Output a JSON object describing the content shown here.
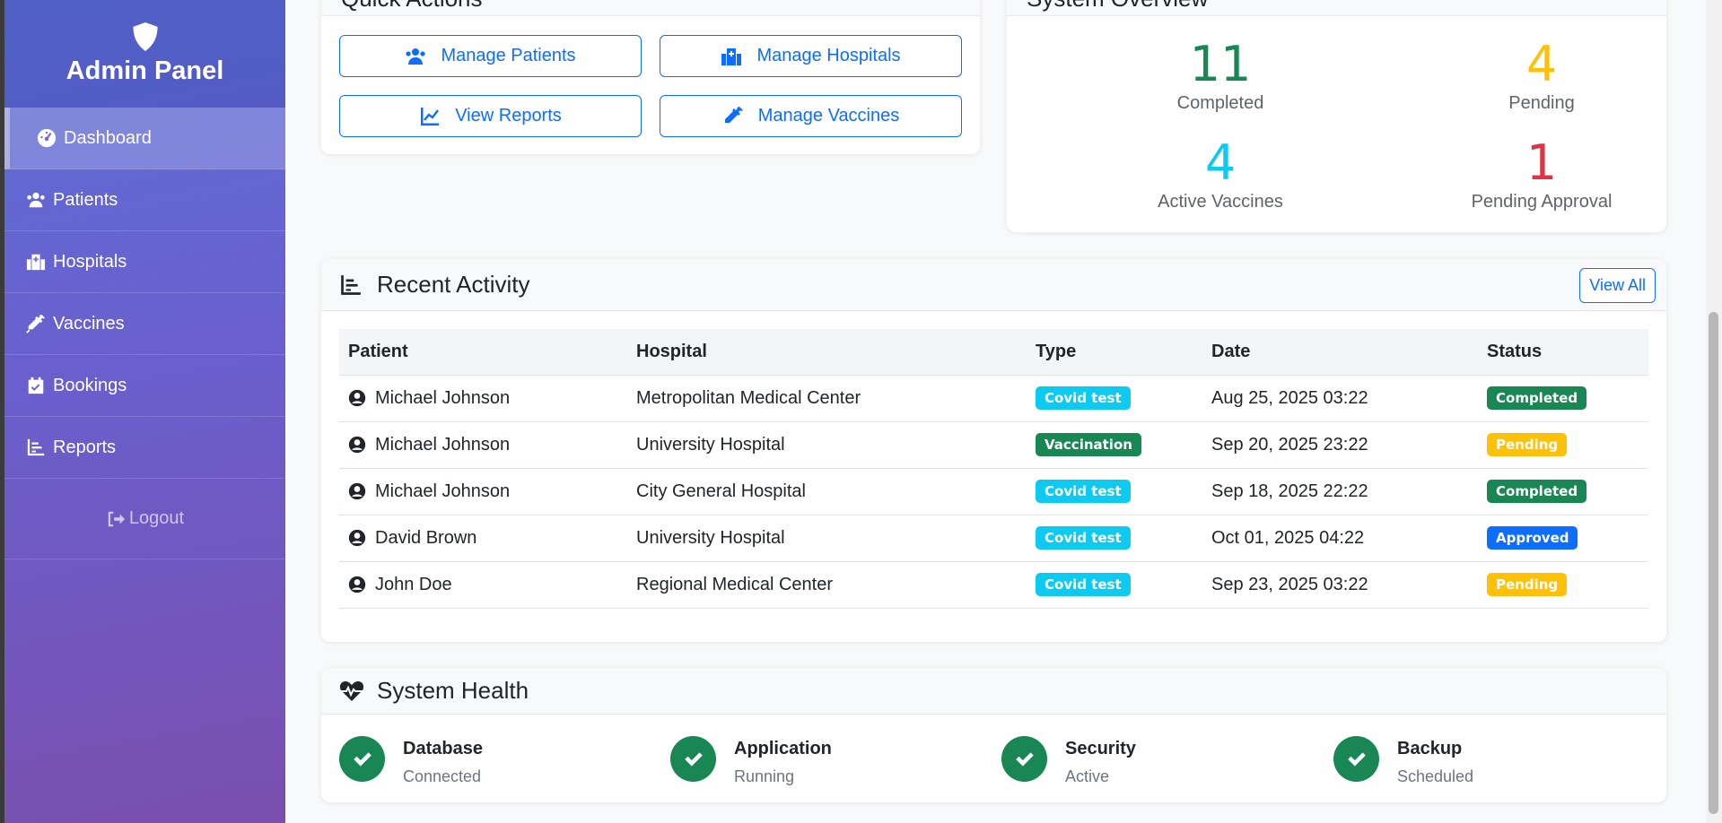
{
  "sidebar": {
    "brand": "Admin Panel",
    "items": [
      {
        "label": "Dashboard",
        "icon": "tachometer-icon",
        "active": true
      },
      {
        "label": "Patients",
        "icon": "users-icon"
      },
      {
        "label": "Hospitals",
        "icon": "hospital-icon"
      },
      {
        "label": "Vaccines",
        "icon": "syringe-icon"
      },
      {
        "label": "Bookings",
        "icon": "calendar-check-icon"
      },
      {
        "label": "Reports",
        "icon": "chart-bar-icon"
      }
    ],
    "logout": "Logout"
  },
  "quick_actions": {
    "title": "Quick Actions",
    "buttons": [
      {
        "label": "Manage Patients",
        "icon": "users-icon"
      },
      {
        "label": "Manage Hospitals",
        "icon": "hospital-icon"
      },
      {
        "label": "View Reports",
        "icon": "chart-line-icon"
      },
      {
        "label": "Manage Vaccines",
        "icon": "syringe-icon"
      }
    ]
  },
  "system_overview": {
    "title": "System Overview",
    "stats": [
      {
        "value": "11",
        "label": "Completed",
        "color": "#198754"
      },
      {
        "value": "4",
        "label": "Pending",
        "color": "#ffc107"
      },
      {
        "value": "4",
        "label": "Active Vaccines",
        "color": "#0dcaf0"
      },
      {
        "value": "1",
        "label": "Pending Approval",
        "color": "#dc3545"
      }
    ]
  },
  "recent_activity": {
    "title": "Recent Activity",
    "view_all": "View All",
    "columns": [
      "Patient",
      "Hospital",
      "Type",
      "Date",
      "Status"
    ],
    "rows": [
      {
        "patient": "Michael Johnson",
        "hospital": "Metropolitan Medical Center",
        "type": "Covid test",
        "type_color": "#0dcaf0",
        "date": "Aug 25, 2025 03:22",
        "status": "Completed",
        "status_color": "#198754"
      },
      {
        "patient": "Michael Johnson",
        "hospital": "University Hospital",
        "type": "Vaccination",
        "type_color": "#198754",
        "date": "Sep 20, 2025 23:22",
        "status": "Pending",
        "status_color": "#ffc107"
      },
      {
        "patient": "Michael Johnson",
        "hospital": "City General Hospital",
        "type": "Covid test",
        "type_color": "#0dcaf0",
        "date": "Sep 18, 2025 22:22",
        "status": "Completed",
        "status_color": "#198754"
      },
      {
        "patient": "David Brown",
        "hospital": "University Hospital",
        "type": "Covid test",
        "type_color": "#0dcaf0",
        "date": "Oct 01, 2025 04:22",
        "status": "Approved",
        "status_color": "#0d6efd"
      },
      {
        "patient": "John Doe",
        "hospital": "Regional Medical Center",
        "type": "Covid test",
        "type_color": "#0dcaf0",
        "date": "Sep 23, 2025 03:22",
        "status": "Pending",
        "status_color": "#ffc107"
      }
    ]
  },
  "system_health": {
    "title": "System Health",
    "items": [
      {
        "name": "Database",
        "status": "Connected"
      },
      {
        "name": "Application",
        "status": "Running"
      },
      {
        "name": "Security",
        "status": "Active"
      },
      {
        "name": "Backup",
        "status": "Scheduled"
      }
    ]
  }
}
